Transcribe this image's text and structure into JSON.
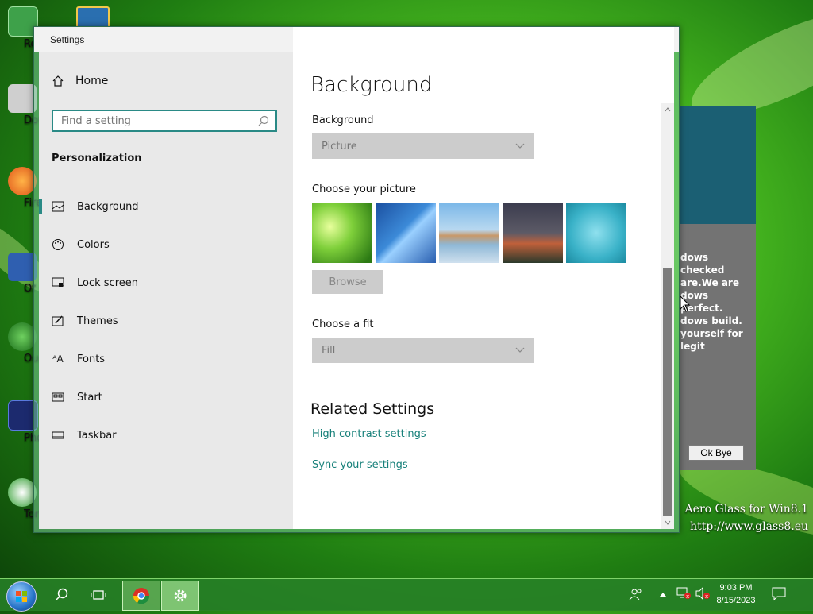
{
  "desktop": {
    "icons": [
      {
        "label": "Recycle"
      },
      {
        "label": "Down Cen"
      },
      {
        "label": "Fire"
      },
      {
        "label": "Of Comm"
      },
      {
        "label": "Our W"
      },
      {
        "label": "Photo"
      },
      {
        "label": "Torr"
      }
    ],
    "popup": {
      "text": "dows\nchecked\nare.We are\ndows\nperfect.\ndows build.\nyourself for\nlegit",
      "ok_label": "Ok Bye"
    },
    "watermark": {
      "line1": "Aero Glass for Win8.1",
      "line2": "http://www.glass8.eu"
    }
  },
  "window": {
    "title": "Settings",
    "controls": {
      "minimize": "minimize-icon",
      "maximize": "maximize-icon",
      "close": "close-icon"
    }
  },
  "sidebar": {
    "home_label": "Home",
    "search_placeholder": "Find a setting",
    "section_title": "Personalization",
    "items": [
      {
        "label": "Background",
        "icon": "picture-icon",
        "active": true
      },
      {
        "label": "Colors",
        "icon": "palette-icon"
      },
      {
        "label": "Lock screen",
        "icon": "lock-screen-icon"
      },
      {
        "label": "Themes",
        "icon": "themes-icon"
      },
      {
        "label": "Fonts",
        "icon": "fonts-icon"
      },
      {
        "label": "Start",
        "icon": "start-icon"
      },
      {
        "label": "Taskbar",
        "icon": "taskbar-icon"
      }
    ]
  },
  "main": {
    "title": "Background",
    "background_label": "Background",
    "background_value": "Picture",
    "choose_picture_label": "Choose your picture",
    "browse_label": "Browse",
    "choose_fit_label": "Choose a fit",
    "fit_value": "Fill",
    "related_title": "Related Settings",
    "links": [
      "High contrast settings",
      "Sync your settings"
    ]
  },
  "taskbar": {
    "time": "9:03 PM",
    "date": "8/15/2023"
  },
  "colors": {
    "accent": "#17807a"
  }
}
